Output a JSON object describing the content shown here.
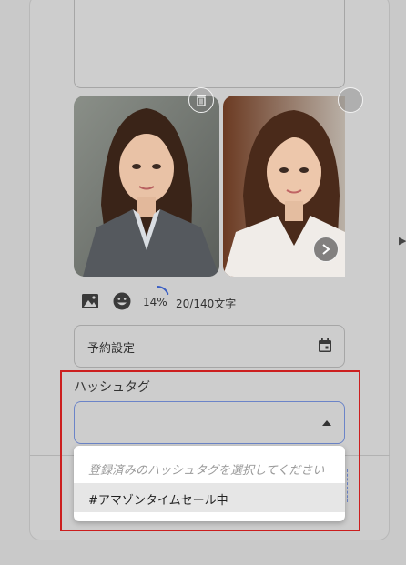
{
  "composer": {
    "progress_percent_label": "14%",
    "progress_value": 0.14,
    "char_counter": "20/140文字"
  },
  "schedule": {
    "label": "予約設定"
  },
  "hashtag": {
    "label": "ハッシュタグ",
    "placeholder": "登録済みのハッシュタグを選択してください",
    "options": [
      "#アマゾンタイムセール中"
    ]
  },
  "icons": {
    "image": "image-icon",
    "emoji": "emoji-icon",
    "calendar": "calendar-icon",
    "trash": "trash-icon",
    "next": "chevron-right-icon",
    "caret": "caret-up-icon"
  },
  "colors": {
    "background": "#c9c9c9",
    "focus_border": "#6b84c8",
    "progress_ring": "#3b5fc4",
    "highlight": "#cc1f1f"
  }
}
